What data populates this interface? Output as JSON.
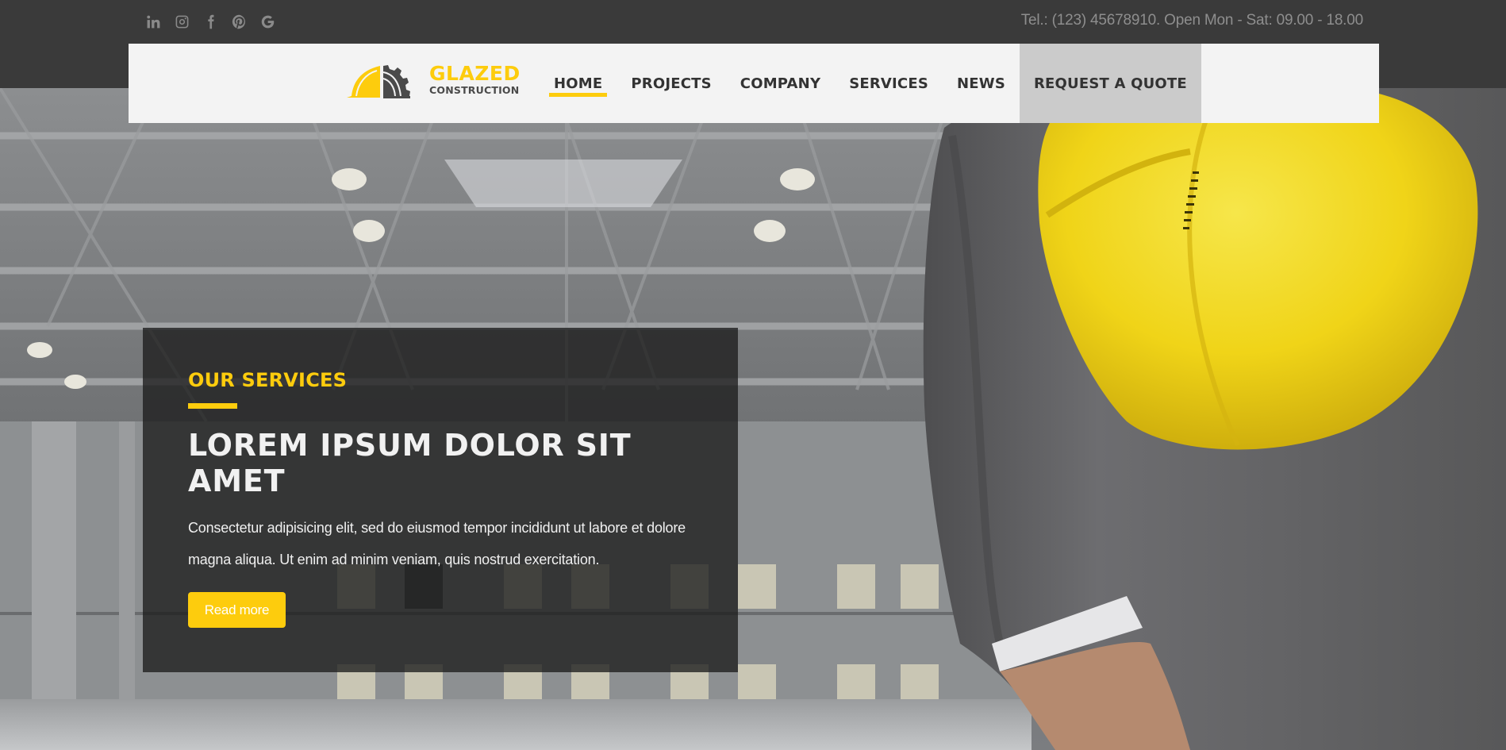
{
  "topbar": {
    "social_icons": [
      {
        "name": "linkedin-icon",
        "label": "LinkedIn"
      },
      {
        "name": "instagram-icon",
        "label": "Instagram"
      },
      {
        "name": "facebook-icon",
        "label": "Facebook"
      },
      {
        "name": "pinterest-icon",
        "label": "Pinterest"
      },
      {
        "name": "google-icon",
        "label": "Google"
      }
    ],
    "contact_text": "Tel.: (123) 45678910. Open Mon - Sat: 09.00 - 18.00"
  },
  "brand": {
    "name": "GLAZED",
    "tagline": "CONSTRUCTION",
    "accent_color": "#fdcc0d",
    "dark_color": "#4a4a4a"
  },
  "nav": {
    "items": [
      {
        "label": "HOME",
        "active": true
      },
      {
        "label": "PROJECTS",
        "active": false
      },
      {
        "label": "COMPANY",
        "active": false
      },
      {
        "label": "SERVICES",
        "active": false
      },
      {
        "label": "NEWS",
        "active": false
      }
    ],
    "cta_label": "REQUEST A QUOTE"
  },
  "hero": {
    "eyebrow": "OUR SERVICES",
    "headline": "LOREM IPSUM DOLOR SIT AMET",
    "body": "Consectetur adipisicing elit, sed do eiusmod tempor incididunt ut labore et dolore magna aliqua. Ut enim ad minim veniam, quis nostrud exercitation.",
    "button_label": "Read more",
    "image_description": "Industrial warehouse interior with steel roof trusses and a businessman holding a yellow hard hat"
  }
}
